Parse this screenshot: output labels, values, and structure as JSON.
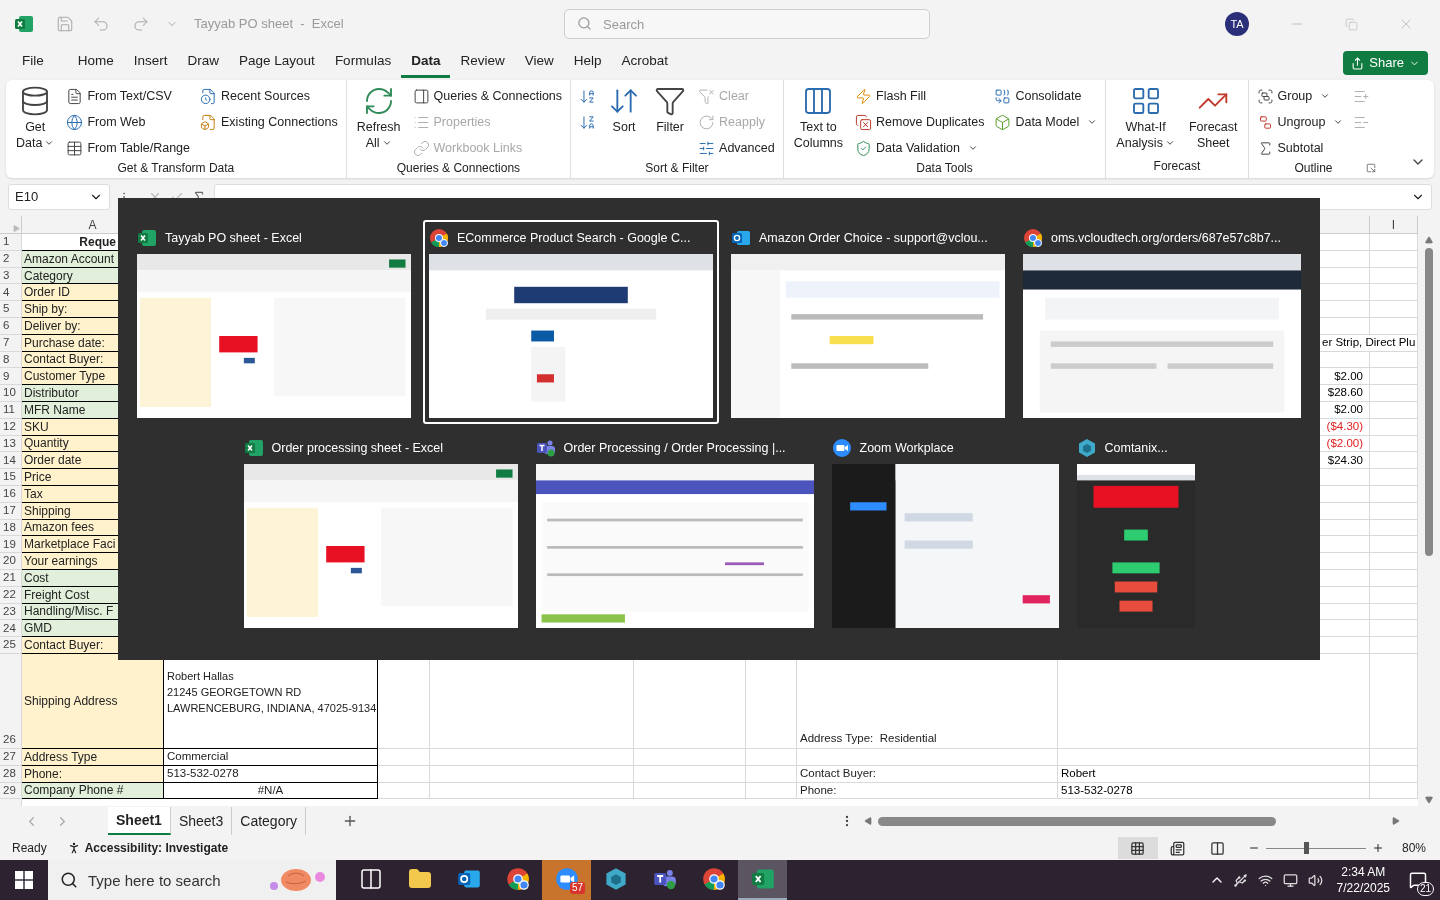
{
  "title_bar": {
    "title": "Tayyab PO sheet  -  Excel",
    "search_placeholder": "Search",
    "avatar": "TA"
  },
  "menu_tabs": [
    {
      "label": "File",
      "selected": false
    },
    {
      "label": "Home",
      "selected": false
    },
    {
      "label": "Insert",
      "selected": false
    },
    {
      "label": "Draw",
      "selected": false
    },
    {
      "label": "Page Layout",
      "selected": false
    },
    {
      "label": "Formulas",
      "selected": false
    },
    {
      "label": "Data",
      "selected": true
    },
    {
      "label": "Review",
      "selected": false
    },
    {
      "label": "View",
      "selected": false
    },
    {
      "label": "Help",
      "selected": false
    },
    {
      "label": "Acrobat",
      "selected": false
    }
  ],
  "share_button": "Share",
  "ribbon_groups": [
    {
      "label": "Get & Transform Data",
      "controls": [
        {
          "kind": "large",
          "lines": [
            "Get",
            "Data"
          ],
          "dropdown": true
        },
        {
          "kind": "stack",
          "items": [
            {
              "label": "From Text/CSV",
              "disabled": false,
              "dropdown": false
            },
            {
              "label": "From Web",
              "disabled": false,
              "dropdown": false
            },
            {
              "label": "From Table/Range",
              "disabled": false,
              "dropdown": false
            }
          ]
        },
        {
          "kind": "stack",
          "items": [
            {
              "label": "Recent Sources",
              "disabled": false,
              "dropdown": false
            },
            {
              "label": "Existing Connections",
              "disabled": false,
              "dropdown": false
            }
          ]
        }
      ]
    },
    {
      "label": "Queries & Connections",
      "controls": [
        {
          "kind": "large",
          "lines": [
            "Refresh",
            "All"
          ],
          "dropdown": true
        },
        {
          "kind": "stack",
          "items": [
            {
              "label": "Queries & Connections",
              "disabled": false,
              "dropdown": false
            },
            {
              "label": "Properties",
              "disabled": true,
              "dropdown": false
            },
            {
              "label": "Workbook Links",
              "disabled": true,
              "dropdown": false
            }
          ]
        }
      ]
    },
    {
      "label": "Sort & Filter",
      "controls": [
        {
          "kind": "stack",
          "items": [
            {
              "disabled": false,
              "dropdown": false
            },
            {
              "disabled": false,
              "dropdown": false
            }
          ]
        },
        {
          "kind": "large",
          "lines": [
            "Sort"
          ],
          "dropdown": false
        },
        {
          "kind": "large",
          "lines": [
            "Filter"
          ],
          "dropdown": false
        },
        {
          "kind": "stack",
          "items": [
            {
              "label": "Clear",
              "disabled": true,
              "dropdown": false
            },
            {
              "label": "Reapply",
              "disabled": true,
              "dropdown": false
            },
            {
              "label": "Advanced",
              "disabled": false,
              "dropdown": false
            }
          ]
        }
      ]
    },
    {
      "label": "Data Tools",
      "controls": [
        {
          "kind": "large",
          "lines": [
            "Text to",
            "Columns"
          ],
          "dropdown": false
        },
        {
          "kind": "stack",
          "items": [
            {
              "label": "Flash Fill",
              "disabled": false,
              "dropdown": false
            },
            {
              "label": "Remove Duplicates",
              "disabled": false,
              "dropdown": false
            },
            {
              "label": "Data Validation",
              "disabled": false,
              "dropdown": true
            }
          ]
        },
        {
          "kind": "stack",
          "items": [
            {
              "label": "Consolidate",
              "disabled": false,
              "dropdown": false
            },
            {
              "label": "Data Model",
              "disabled": false,
              "dropdown": true
            }
          ]
        }
      ]
    },
    {
      "label": "Forecast",
      "controls": [
        {
          "kind": "large",
          "lines": [
            "What-If",
            "Analysis"
          ],
          "dropdown": true
        },
        {
          "kind": "large",
          "lines": [
            "Forecast",
            "Sheet"
          ],
          "dropdown": false
        }
      ]
    },
    {
      "label": "Outline",
      "controls": [
        {
          "kind": "stack",
          "items": [
            {
              "label": "Group",
              "disabled": false,
              "dropdown": true
            },
            {
              "label": "Ungroup",
              "disabled": false,
              "dropdown": true
            },
            {
              "label": "Subtotal",
              "disabled": false,
              "dropdown": false
            }
          ]
        },
        {
          "kind": "stack",
          "items": [
            {
              "disabled": true,
              "dropdown": false
            },
            {
              "disabled": true,
              "dropdown": false
            }
          ]
        }
      ]
    }
  ],
  "name_box": "E10",
  "column_headers": [
    "A",
    "I"
  ],
  "rows": [
    {
      "number": "1",
      "kind": "header",
      "label": "Reque"
    },
    {
      "number": "2",
      "kind": "field",
      "label": "Amazon Account",
      "color": "#e2efda"
    },
    {
      "number": "3",
      "kind": "field",
      "label": "Category",
      "color": "#e2efda"
    },
    {
      "number": "4",
      "kind": "field",
      "label": "Order ID",
      "color": "#fff2cc"
    },
    {
      "number": "5",
      "kind": "field",
      "label": "Ship by:",
      "color": "#fff2cc"
    },
    {
      "number": "6",
      "kind": "field",
      "label": "Deliver by:",
      "color": "#fff2cc"
    },
    {
      "number": "7",
      "kind": "field",
      "label": "Purchase date:",
      "color": "#fff2cc",
      "column_h": {
        "text": "er Strip, Direct Plu",
        "kind": "spill",
        "negative": false
      }
    },
    {
      "number": "8",
      "kind": "field",
      "label": "Contact Buyer:",
      "color": "#fff2cc"
    },
    {
      "number": "9",
      "kind": "field",
      "label": "Customer Type",
      "color": "#fff2cc",
      "column_h": {
        "text": "$2.00",
        "kind": "amount",
        "negative": false
      }
    },
    {
      "number": "10",
      "kind": "field",
      "label": "Distributor",
      "color": "#e2efda",
      "column_h": {
        "text": "$28.60",
        "kind": "amount",
        "negative": false
      }
    },
    {
      "number": "11",
      "kind": "field",
      "label": "MFR Name",
      "color": "#e2efda",
      "column_h": {
        "text": "$2.00",
        "kind": "amount",
        "negative": false
      }
    },
    {
      "number": "12",
      "kind": "field",
      "label": "SKU",
      "color": "#fff2cc",
      "column_h": {
        "text": "($4.30)",
        "kind": "amount",
        "negative": true
      }
    },
    {
      "number": "13",
      "kind": "field",
      "label": "Quantity",
      "color": "#fff2cc",
      "column_h": {
        "text": "($2.00)",
        "kind": "amount",
        "negative": true
      }
    },
    {
      "number": "14",
      "kind": "field",
      "label": "Order date",
      "color": "#fff2cc",
      "column_h": {
        "text": "$24.30",
        "kind": "amount",
        "negative": false
      }
    },
    {
      "number": "15",
      "kind": "field",
      "label": "Price",
      "color": "#fff2cc"
    },
    {
      "number": "16",
      "kind": "field",
      "label": "Tax",
      "color": "#fff2cc"
    },
    {
      "number": "17",
      "kind": "field",
      "label": "Shipping",
      "color": "#fff2cc"
    },
    {
      "number": "18",
      "kind": "field",
      "label": "Amazon fees",
      "color": "#fff2cc"
    },
    {
      "number": "19",
      "kind": "field",
      "label": "Marketplace Faci",
      "color": "#fff2cc"
    },
    {
      "number": "20",
      "kind": "field",
      "label": "Your earnings",
      "color": "#fff2cc"
    },
    {
      "number": "21",
      "kind": "field",
      "label": "Cost",
      "color": "#e2efda"
    },
    {
      "number": "22",
      "kind": "field",
      "label": "Freight Cost",
      "color": "#e2efda"
    },
    {
      "number": "23",
      "kind": "field",
      "label": "Handling/Misc. F",
      "color": "#e2efda"
    },
    {
      "number": "24",
      "kind": "field",
      "label": "GMD",
      "color": "#e2efda"
    },
    {
      "number": "25",
      "kind": "field",
      "label": "Contact Buyer:",
      "color": "#fff2cc"
    },
    {
      "number": "26",
      "kind": "field",
      "label": "Shipping Address",
      "color": "#fff2cc",
      "value_lines": [
        "Robert Hallas",
        "21245 GEORGETOWN RD",
        "LAWRENCEBURG, INDIANA, 47025-9134"
      ],
      "column_g": "Address Type:  Residential"
    },
    {
      "number": "27",
      "kind": "field",
      "label": "Address Type",
      "color": "#fff2cc",
      "value": "Commercial"
    },
    {
      "number": "28",
      "kind": "field",
      "label": "Phone:",
      "color": "#fff2cc",
      "value": "513-532-0278",
      "column_g": "Contact Buyer:",
      "column_h": {
        "text": "Robert",
        "kind": "text",
        "negative": false
      }
    },
    {
      "number": "29",
      "kind": "field",
      "label": "Company Phone #",
      "color": "#e2efda",
      "value": "#N/A",
      "centered": true,
      "column_g": "Phone:",
      "column_h": {
        "text": "513-532-0278",
        "kind": "text",
        "negative": false
      }
    }
  ],
  "window_switcher": [
    [
      {
        "title": "Tayyab PO sheet - Excel",
        "kind": "excel",
        "selected": false
      },
      {
        "title": "ECommerce Product Search - Google C...",
        "kind": "chrome",
        "selected": true
      },
      {
        "title": "Amazon Order Choice - support@vclou...",
        "kind": "outlook",
        "selected": false
      },
      {
        "title": "oms.vcloudtech.org/orders/687e57c8b7...",
        "kind": "chrome",
        "selected": false
      }
    ],
    [
      {
        "title": "Order processing sheet - Excel",
        "kind": "excel",
        "selected": false
      },
      {
        "title": "Order Processing / Order Processing |...",
        "kind": "teams",
        "selected": false
      },
      {
        "title": "Zoom Workplace",
        "kind": "zoom",
        "selected": false
      },
      {
        "title": "Comtanix...",
        "kind": "comtanix",
        "selected": false
      }
    ]
  ],
  "sheet_tabs": [
    {
      "label": "Sheet1",
      "selected": true
    },
    {
      "label": "Sheet3",
      "selected": false
    },
    {
      "label": "Category",
      "selected": false
    }
  ],
  "status_bar": {
    "ready": "Ready",
    "accessibility": "Accessibility: Investigate",
    "views": [
      {
        "kind": "normal",
        "selected": true
      },
      {
        "kind": "page-layout",
        "selected": false
      },
      {
        "kind": "page-break",
        "selected": false
      }
    ],
    "zoom": {
      "level": 0.38,
      "reading": "80%"
    }
  },
  "taskbar": {
    "search_placeholder": "Type here to search",
    "apps": [
      {
        "kind": "task-view",
        "active": false,
        "attention": false
      },
      {
        "kind": "explorer",
        "active": false,
        "attention": false
      },
      {
        "kind": "outlook",
        "active": false,
        "attention": false
      },
      {
        "kind": "chrome",
        "active": false,
        "attention": false
      },
      {
        "kind": "zoom",
        "active": false,
        "attention": true,
        "badge": "57"
      },
      {
        "kind": "comtanix",
        "active": false,
        "attention": false
      },
      {
        "kind": "teams",
        "active": false,
        "attention": false
      },
      {
        "kind": "chrome",
        "active": false,
        "attention": false
      },
      {
        "kind": "excel",
        "active": true,
        "attention": false
      }
    ],
    "time": "2:34 AM",
    "date": "7/22/2025",
    "notifications": "21"
  }
}
